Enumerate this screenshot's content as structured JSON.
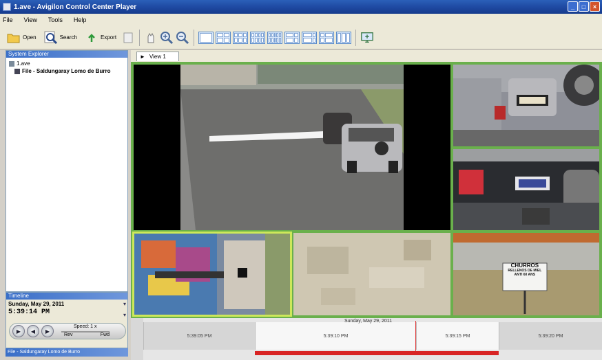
{
  "window": {
    "title": "1.ave - Avigilon Control Center Player",
    "buttons": {
      "min": "_",
      "max": "□",
      "close": "×"
    }
  },
  "menu": [
    "File",
    "View",
    "Tools",
    "Help"
  ],
  "toolbar": {
    "open_label": "Open",
    "search_label": "Search",
    "export_label": "Export"
  },
  "system_explorer": {
    "header": "System Explorer",
    "root": "1.ave",
    "file_item": "File - Saldungaray Lomo de Burro"
  },
  "view_tab": {
    "label": "View 1",
    "arrow": "►"
  },
  "timeline_panel": {
    "header": "Timeline",
    "date": "Sunday, May 29, 2011",
    "time": "5:39:14 PM",
    "tz": "PM",
    "speed_label": "Speed: 1 x",
    "rev_label": "Rev",
    "fwd_label": "Fwd"
  },
  "status_strip": "File - Saldungaray Lomo de Burro",
  "timeline_track": {
    "date": "Sunday, May 29, 2011",
    "ticks": [
      "5:39:05 PM",
      "5:39:10 PM",
      "5:39:15 PM",
      "5:39:20 PM"
    ]
  },
  "tiles": {
    "big": "street-view",
    "t1": "car-rear-plate-1",
    "t2": "car-rear-plate-2",
    "b1": "graffiti-wall",
    "b2": "textured-wall",
    "b3": "churros-sign"
  },
  "sign_text": {
    "line1": "CHURROS",
    "line2": "RELLENOS DE MIEL",
    "line3": "ANTI 60 ANS"
  },
  "colors": {
    "title_blue": "#1f4aa3",
    "tile_border": "#6ab04c",
    "selected_border": "#cde85a",
    "record_red": "#d82424"
  }
}
